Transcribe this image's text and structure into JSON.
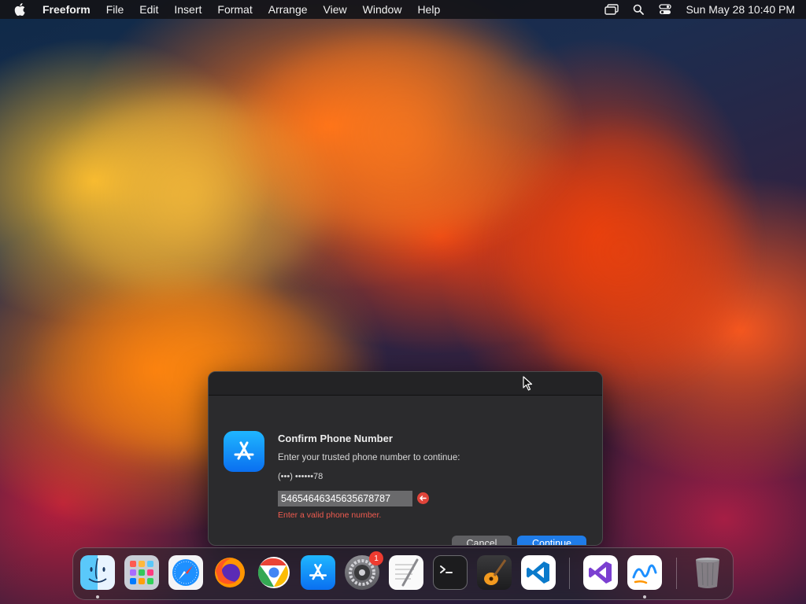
{
  "menubar": {
    "app_name": "Freeform",
    "items": [
      "File",
      "Edit",
      "Insert",
      "Format",
      "Arrange",
      "View",
      "Window",
      "Help"
    ],
    "status_icons": [
      "screen-mirroring-icon",
      "spotlight-search-icon",
      "control-center-icon"
    ],
    "clock": "Sun May 28  10:40 PM"
  },
  "dialog": {
    "heading": "Confirm Phone Number",
    "subtext": "Enter your trusted phone number to continue:",
    "masked_number": "(•••) ••••••78",
    "phone_value": "54654646345635678787",
    "error_text": "Enter a valid phone number.",
    "cancel_label": "Cancel",
    "continue_label": "Continue",
    "icon": "app-store-icon",
    "accent_color": "#1f7ce8",
    "error_color": "#ef5b4f"
  },
  "dock": {
    "apps": [
      {
        "name": "Finder",
        "icon": "finder-icon",
        "running": true
      },
      {
        "name": "Launchpad",
        "icon": "launchpad-icon"
      },
      {
        "name": "Safari",
        "icon": "safari-icon"
      },
      {
        "name": "Firefox",
        "icon": "firefox-icon"
      },
      {
        "name": "Chrome",
        "icon": "chrome-icon"
      },
      {
        "name": "App Store",
        "icon": "app-store-icon"
      },
      {
        "name": "System Settings",
        "icon": "settings-icon",
        "badge": "1"
      },
      {
        "name": "TextEdit",
        "icon": "textedit-icon"
      },
      {
        "name": "Terminal",
        "icon": "terminal-icon"
      },
      {
        "name": "GarageBand",
        "icon": "garageband-icon"
      },
      {
        "name": "Visual Studio Code",
        "icon": "vscode-icon"
      },
      {
        "name": "Visual Studio",
        "icon": "visual-studio-icon"
      },
      {
        "name": "Freeform",
        "icon": "freeform-icon",
        "running": true
      },
      {
        "name": "Trash",
        "icon": "trash-icon"
      }
    ]
  }
}
